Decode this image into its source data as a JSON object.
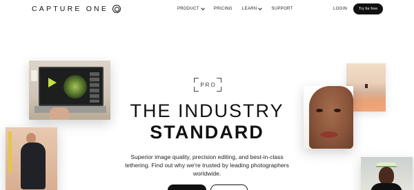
{
  "header": {
    "logo_text": "CAPTURE ONE",
    "nav": [
      {
        "label": "PRODUCT",
        "has_dropdown": true
      },
      {
        "label": "PRICING",
        "has_dropdown": false
      },
      {
        "label": "LEARN",
        "has_dropdown": true
      },
      {
        "label": "SUPPORT",
        "has_dropdown": false
      }
    ],
    "login": "LOGIN",
    "try_button": "Try for free"
  },
  "hero": {
    "badge": "PRO",
    "headline_line1": "THE INDUSTRY",
    "headline_line2": "STANDARD",
    "subtext": "Superior image quality, precision editing, and best-in-class tethering. Find out why we're trusted by leading photographers worldwide.",
    "primary_cta": "",
    "secondary_cta": ""
  },
  "colors": {
    "brand": "#111111",
    "button_text": "#ffffff",
    "background": "#ffffff"
  }
}
